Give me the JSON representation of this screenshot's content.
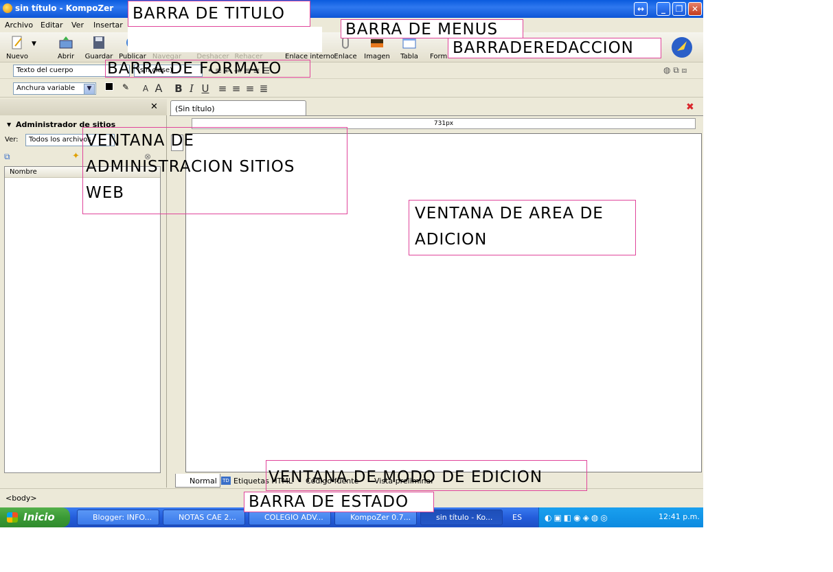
{
  "window": {
    "title": "sin título - KompoZer"
  },
  "menus": [
    "Archivo",
    "Editar",
    "Ver",
    "Insertar"
  ],
  "toolbar": {
    "new": "Nuevo",
    "open": "Abrir",
    "save": "Guardar",
    "publish": "Publicar",
    "browse": "Navegar",
    "undo": "Deshacer",
    "redo": "Rehacer",
    "anchor": "Enlace interno",
    "link": "Enlace",
    "image": "Imagen",
    "table": "Tabla",
    "form": "Formulario",
    "cascades": "CaScadeS"
  },
  "format": {
    "paragraph": "Texto del cuerpo",
    "class": "(sin clase)",
    "width": "Anchura variable"
  },
  "sidebar": {
    "title": "Administrador de sitios",
    "view_label": "Ver:",
    "view_value": "Todos los archivos",
    "column": "Nombre"
  },
  "editor": {
    "tab": "(Sin título)",
    "ruler": "731px"
  },
  "modes": [
    "Normal",
    "Etiquetas HTML",
    "Código fuente",
    "Vista preliminar"
  ],
  "status": {
    "path": "<body>"
  },
  "taskbar": {
    "start": "Inicio",
    "items": [
      "Blogger: INFO...",
      "NOTAS CAE 2...",
      "COLEGIO ADV...",
      "KompoZer 0.7...",
      "sin título - Ko..."
    ],
    "lang": "ES",
    "clock": "12:41 p.m."
  },
  "annotations": {
    "title_bar": "BARRA DE TITULO",
    "menu_bar": "BARRA DE MENUS",
    "edit_bar": "BARRADEREDACCION",
    "format_bar": "BARRA DE FORMATO",
    "site_admin": [
      "VENTANA DE",
      "ADMINISTRACION SITIOS",
      "WEB"
    ],
    "area": [
      "VENTANA DE AREA DE",
      "ADICION"
    ],
    "mode": "VENTANA DE MODO DE EDICION",
    "status": "BARRA DE ESTADO"
  },
  "colors": {
    "annotation_border": "#e0449a",
    "xp_blue": "#245ddb",
    "start_green": "#3a9a36"
  }
}
